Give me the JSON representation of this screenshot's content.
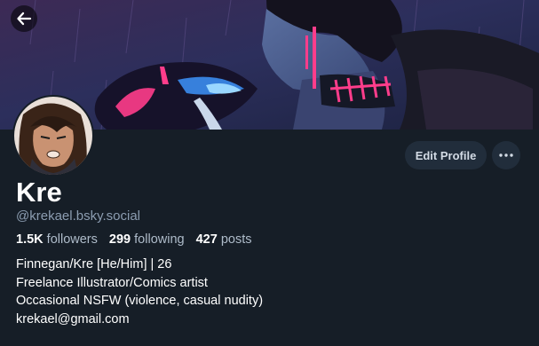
{
  "profile": {
    "display_name": "Kre",
    "handle": "@krekael.bsky.social",
    "stats": {
      "followers_count": "1.5K",
      "followers_label": "followers",
      "following_count": "299",
      "following_label": "following",
      "posts_count": "427",
      "posts_label": "posts"
    },
    "bio_lines": [
      "Finnegan/Kre [He/Him] | 26",
      "Freelance Illustrator/Comics artist",
      "Occasional NSFW (violence, casual nudity)",
      "krekael@gmail.com"
    ]
  },
  "actions": {
    "edit_profile_label": "Edit Profile",
    "back_icon": "arrow-left-icon",
    "more_icon": "ellipsis-icon"
  },
  "colors": {
    "background": "#161e27",
    "button_bg": "#212d3b",
    "muted_text": "#8c9db1",
    "accent_pink": "#ff3d8b"
  }
}
